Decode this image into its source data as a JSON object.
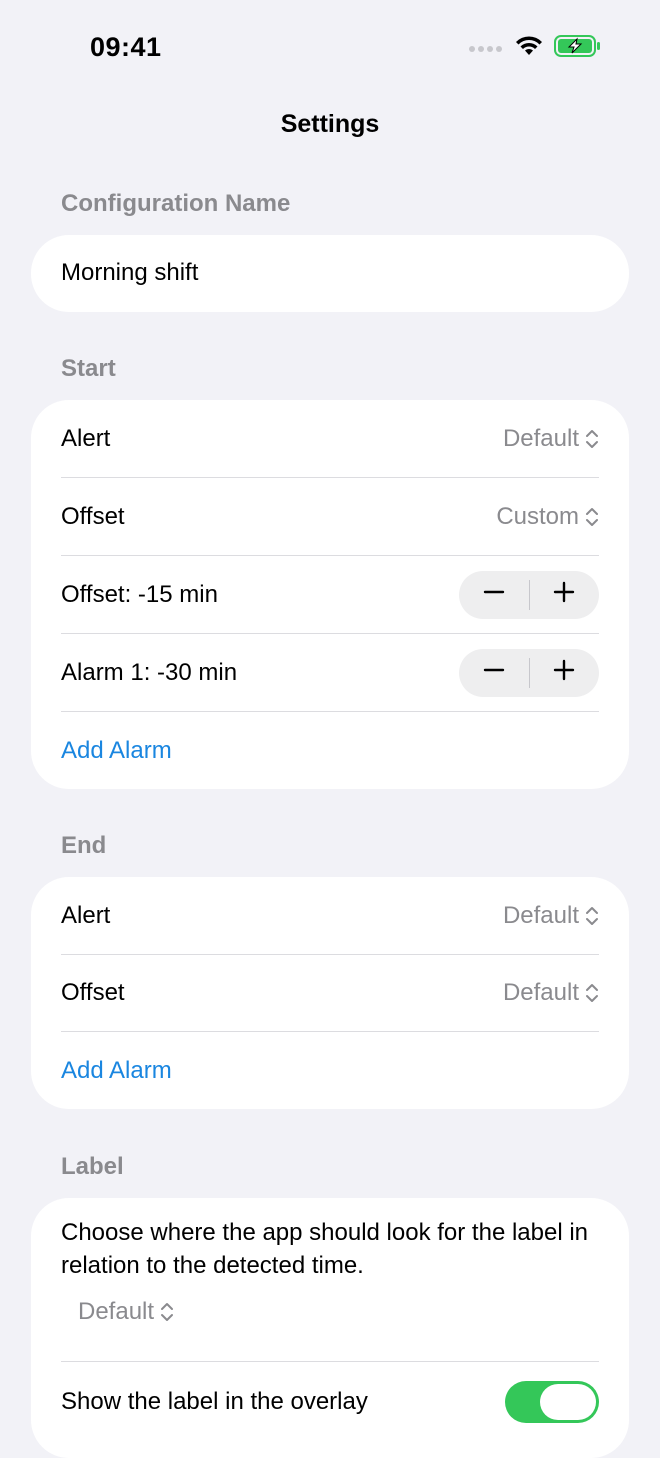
{
  "status_bar": {
    "time": "09:41"
  },
  "nav": {
    "title": "Settings"
  },
  "config_name": {
    "header": "Configuration Name",
    "value": "Morning shift"
  },
  "start": {
    "header": "Start",
    "alert_label": "Alert",
    "alert_value": "Default",
    "offset_label": "Offset",
    "offset_value": "Custom",
    "offset_stepper_label": "Offset: -15 min",
    "alarm1_label": "Alarm 1: -30 min",
    "add_alarm": "Add Alarm"
  },
  "end": {
    "header": "End",
    "alert_label": "Alert",
    "alert_value": "Default",
    "offset_label": "Offset",
    "offset_value": "Default",
    "add_alarm": "Add Alarm"
  },
  "label_section": {
    "header": "Label",
    "description": "Choose where the app should look for the label in relation to the detected time.",
    "position_value": "Default",
    "overlay_label": "Show the label in the overlay",
    "overlay_enabled": true
  },
  "colors": {
    "background": "#f2f2f7",
    "accent_link": "#1a86e0",
    "toggle_on": "#34c759",
    "secondary_text": "#8a8a8e"
  },
  "icons": [
    "wifi-icon",
    "battery-charging-icon",
    "cellular-signal-icon",
    "chevron-updown-icon",
    "minus-icon",
    "plus-icon"
  ]
}
